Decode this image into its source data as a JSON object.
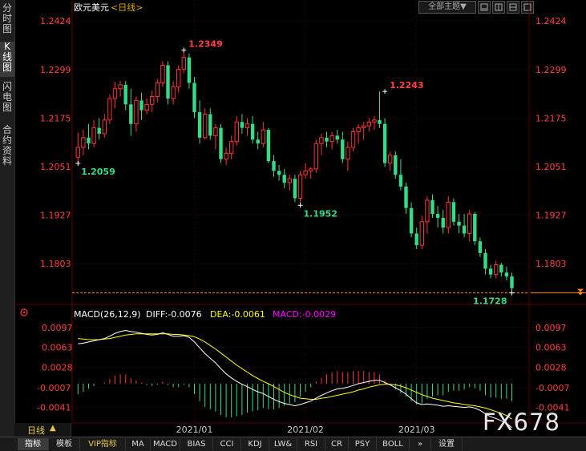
{
  "sidebar": {
    "tabs": [
      {
        "label": "分时图",
        "active": false
      },
      {
        "label": "K线图",
        "active": true
      },
      {
        "label": "闪电图",
        "active": false
      },
      {
        "label": "合约资料",
        "active": false
      }
    ]
  },
  "header": {
    "symbol": "欧元美元",
    "period_tag": "<日线>",
    "theme_dropdown": "全部主题",
    "dropdown_arrow": "▼"
  },
  "colors": {
    "up": "#ff3333",
    "down": "#33dd88",
    "axis_text_up": "#ff4040",
    "grid": "#4a0000",
    "diff_line": "#ffffff",
    "dea_line": "#ffff00",
    "macd_text": "#ff00ff",
    "last_price_line": "#ff8800"
  },
  "chart_data": [
    {
      "type": "candlestick",
      "title": "欧元美元<日线>",
      "ylim": [
        1.1715,
        1.244
      ],
      "y_ticks": [
        "1.2424",
        "1.2299",
        "1.2175",
        "1.2051",
        "1.1927",
        "1.1803"
      ],
      "x_ticks": [
        "2021/01",
        "2021/02",
        "2021/03"
      ],
      "x_tick_index": [
        22,
        43,
        64
      ],
      "annotations": [
        {
          "index": 20,
          "value": 1.2349,
          "label": "1.2349"
        },
        {
          "index": 58,
          "value": 1.2243,
          "label": "1.2243"
        },
        {
          "index": 0,
          "value": 1.2059,
          "label": "1.2059"
        },
        {
          "index": 42,
          "value": 1.1952,
          "label": "1.1952"
        },
        {
          "index": 82,
          "value": 1.1728,
          "label": "1.1728"
        }
      ],
      "last_price": 1.1728,
      "ohlc": [
        [
          1.2075,
          1.2138,
          1.2059,
          1.21
        ],
        [
          1.21,
          1.2145,
          1.208,
          1.2125
        ],
        [
          1.2125,
          1.216,
          1.2095,
          1.211
        ],
        [
          1.211,
          1.217,
          1.21,
          1.215
        ],
        [
          1.215,
          1.2175,
          1.212,
          1.2135
        ],
        [
          1.2135,
          1.2185,
          1.2125,
          1.217
        ],
        [
          1.217,
          1.2235,
          1.216,
          1.2225
        ],
        [
          1.2225,
          1.2268,
          1.22,
          1.225
        ],
        [
          1.225,
          1.227,
          1.223,
          1.226
        ],
        [
          1.226,
          1.227,
          1.2195,
          1.221
        ],
        [
          1.221,
          1.225,
          1.213,
          1.216
        ],
        [
          1.216,
          1.223,
          1.214,
          1.222
        ],
        [
          1.222,
          1.224,
          1.217,
          1.2195
        ],
        [
          1.2195,
          1.2225,
          1.2185,
          1.221
        ],
        [
          1.221,
          1.2245,
          1.219,
          1.223
        ],
        [
          1.223,
          1.2275,
          1.2215,
          1.2265
        ],
        [
          1.2265,
          1.232,
          1.2255,
          1.231
        ],
        [
          1.231,
          1.232,
          1.221,
          1.2225
        ],
        [
          1.2225,
          1.227,
          1.221,
          1.2255
        ],
        [
          1.2255,
          1.231,
          1.224,
          1.23
        ],
        [
          1.23,
          1.2349,
          1.229,
          1.233
        ],
        [
          1.233,
          1.234,
          1.225,
          1.2265
        ],
        [
          1.2265,
          1.228,
          1.2175,
          1.219
        ],
        [
          1.219,
          1.222,
          1.211,
          1.2125
        ],
        [
          1.2125,
          1.22,
          1.212,
          1.2185
        ],
        [
          1.2185,
          1.22,
          1.212,
          1.213
        ],
        [
          1.213,
          1.216,
          1.2095,
          1.215
        ],
        [
          1.215,
          1.216,
          1.206,
          1.207
        ],
        [
          1.207,
          1.21,
          1.2055,
          1.2085
        ],
        [
          1.2085,
          1.213,
          1.207,
          1.2115
        ],
        [
          1.2115,
          1.218,
          1.2105,
          1.2165
        ],
        [
          1.2165,
          1.2185,
          1.2135,
          1.215
        ],
        [
          1.215,
          1.2175,
          1.213,
          1.216
        ],
        [
          1.216,
          1.218,
          1.211,
          1.212
        ],
        [
          1.212,
          1.214,
          1.2095,
          1.211
        ],
        [
          1.211,
          1.2165,
          1.21,
          1.2145
        ],
        [
          1.2145,
          1.215,
          1.206,
          1.2065
        ],
        [
          1.2065,
          1.208,
          1.2025,
          1.204
        ],
        [
          1.204,
          1.2055,
          1.2015,
          1.203
        ],
        [
          1.203,
          1.2045,
          1.1995,
          1.201
        ],
        [
          1.201,
          1.203,
          1.199,
          1.202
        ],
        [
          1.202,
          1.203,
          1.196,
          1.197
        ],
        [
          1.197,
          1.204,
          1.1952,
          1.203
        ],
        [
          1.203,
          1.206,
          1.202,
          1.204
        ],
        [
          1.204,
          1.205,
          1.202,
          1.2045
        ],
        [
          1.2045,
          1.212,
          1.2035,
          1.211
        ],
        [
          1.211,
          1.2135,
          1.208,
          1.2125
        ],
        [
          1.2125,
          1.214,
          1.21,
          1.2115
        ],
        [
          1.2115,
          1.214,
          1.2095,
          1.213
        ],
        [
          1.213,
          1.2145,
          1.211,
          1.212
        ],
        [
          1.212,
          1.214,
          1.206,
          1.207
        ],
        [
          1.207,
          1.2115,
          1.204,
          1.21
        ],
        [
          1.21,
          1.215,
          1.209,
          1.214
        ],
        [
          1.214,
          1.216,
          1.211,
          1.215
        ],
        [
          1.215,
          1.2165,
          1.212,
          1.2155
        ],
        [
          1.2155,
          1.2175,
          1.214,
          1.2165
        ],
        [
          1.2165,
          1.218,
          1.2145,
          1.217
        ],
        [
          1.217,
          1.2243,
          1.215,
          1.216
        ],
        [
          1.216,
          1.2175,
          1.205,
          1.206
        ],
        [
          1.206,
          1.209,
          1.204,
          1.208
        ],
        [
          1.208,
          1.209,
          1.202,
          1.203
        ],
        [
          1.203,
          1.207,
          1.199,
          1.2
        ],
        [
          1.2,
          1.201,
          1.193,
          1.1945
        ],
        [
          1.1945,
          1.196,
          1.187,
          1.188
        ],
        [
          1.188,
          1.1895,
          1.184,
          1.185
        ],
        [
          1.185,
          1.1925,
          1.184,
          1.191
        ],
        [
          1.191,
          1.1975,
          1.188,
          1.1965
        ],
        [
          1.1965,
          1.198,
          1.192,
          1.193
        ],
        [
          1.193,
          1.195,
          1.1895,
          1.192
        ],
        [
          1.192,
          1.194,
          1.188,
          1.1895
        ],
        [
          1.1895,
          1.1975,
          1.188,
          1.196
        ],
        [
          1.196,
          1.197,
          1.19,
          1.191
        ],
        [
          1.191,
          1.193,
          1.188,
          1.19
        ],
        [
          1.19,
          1.193,
          1.187,
          1.188
        ],
        [
          1.188,
          1.194,
          1.186,
          1.193
        ],
        [
          1.193,
          1.1935,
          1.185,
          1.186
        ],
        [
          1.186,
          1.187,
          1.182,
          1.183
        ],
        [
          1.183,
          1.184,
          1.1775,
          1.179
        ],
        [
          1.179,
          1.18,
          1.1765,
          1.1775
        ],
        [
          1.1775,
          1.181,
          1.1765,
          1.18
        ],
        [
          1.18,
          1.1805,
          1.177,
          1.178
        ],
        [
          1.178,
          1.1795,
          1.176,
          1.177
        ],
        [
          1.177,
          1.178,
          1.1728,
          1.174
        ]
      ]
    },
    {
      "type": "macd",
      "title": "MACD(26,12,9)",
      "diff_label": "DIFF:-0.0076",
      "dea_label": "DEA:-0.0061",
      "macd_label": "MACD:-0.0029",
      "ylim": [
        -0.0065,
        0.0112
      ],
      "y_ticks": [
        "0.0097",
        "0.0063",
        "0.0028",
        "-0.0007",
        "-0.0041"
      ],
      "diff": [
        0.0069,
        0.007,
        0.0072,
        0.0074,
        0.0076,
        0.0078,
        0.0082,
        0.0087,
        0.009,
        0.0092,
        0.009,
        0.0089,
        0.0087,
        0.0085,
        0.0084,
        0.0085,
        0.0088,
        0.0085,
        0.0082,
        0.0082,
        0.0083,
        0.008,
        0.0072,
        0.0062,
        0.0052,
        0.0044,
        0.0036,
        0.0026,
        0.0017,
        0.001,
        0.0004,
        -0.0001,
        -0.0005,
        -0.001,
        -0.0014,
        -0.0017,
        -0.0022,
        -0.0027,
        -0.0031,
        -0.0034,
        -0.0036,
        -0.0038,
        -0.0036,
        -0.0033,
        -0.003,
        -0.0025,
        -0.002,
        -0.0016,
        -0.0012,
        -0.0009,
        -0.0008,
        -0.0006,
        -0.0003,
        0.0,
        0.0002,
        0.0004,
        0.0006,
        0.0006,
        0.0002,
        -0.0002,
        -0.0007,
        -0.0012,
        -0.0018,
        -0.0026,
        -0.0033,
        -0.0036,
        -0.0035,
        -0.0036,
        -0.0037,
        -0.0039,
        -0.0038,
        -0.0039,
        -0.004,
        -0.0041,
        -0.004,
        -0.0042,
        -0.0046,
        -0.0052,
        -0.0057,
        -0.006,
        -0.0064,
        -0.0068,
        -0.0076
      ],
      "dea": [
        0.0078,
        0.0077,
        0.0076,
        0.0076,
        0.0076,
        0.0077,
        0.0078,
        0.008,
        0.0082,
        0.0084,
        0.0085,
        0.0086,
        0.0086,
        0.0086,
        0.0086,
        0.0086,
        0.0086,
        0.0086,
        0.0085,
        0.0085,
        0.0084,
        0.0083,
        0.0081,
        0.0077,
        0.0072,
        0.0066,
        0.006,
        0.0053,
        0.0046,
        0.0039,
        0.0032,
        0.0026,
        0.002,
        0.0014,
        0.0009,
        0.0004,
        0.0,
        -0.0005,
        -0.001,
        -0.0015,
        -0.0019,
        -0.0022,
        -0.0025,
        -0.0026,
        -0.0027,
        -0.0027,
        -0.0025,
        -0.0024,
        -0.0022,
        -0.002,
        -0.0018,
        -0.0016,
        -0.0014,
        -0.0011,
        -0.0009,
        -0.0006,
        -0.0004,
        -0.0002,
        -0.0001,
        -0.0001,
        -0.0002,
        -0.0004,
        -0.0007,
        -0.0011,
        -0.0015,
        -0.0019,
        -0.0022,
        -0.0025,
        -0.0027,
        -0.0029,
        -0.0031,
        -0.0033,
        -0.0034,
        -0.0036,
        -0.0037,
        -0.0038,
        -0.004,
        -0.0042,
        -0.0045,
        -0.0048,
        -0.0051,
        -0.0055,
        -0.0061
      ],
      "hist": [
        -0.0018,
        -0.0014,
        -0.0008,
        -0.0004,
        0.0,
        0.0002,
        0.0008,
        0.0014,
        0.0016,
        0.0016,
        0.001,
        0.0006,
        0.0002,
        -0.0002,
        -0.0004,
        -0.0002,
        0.0004,
        -0.0002,
        -0.0006,
        -0.0006,
        -0.0002,
        -0.0006,
        -0.0018,
        -0.003,
        -0.004,
        -0.0044,
        -0.0048,
        -0.0054,
        -0.0058,
        -0.0058,
        -0.0056,
        -0.0054,
        -0.005,
        -0.0048,
        -0.0046,
        -0.0042,
        -0.0044,
        -0.0044,
        -0.0042,
        -0.0038,
        -0.0034,
        -0.0032,
        -0.0022,
        -0.0014,
        -0.0006,
        0.0004,
        0.001,
        0.0016,
        0.002,
        0.0022,
        0.002,
        0.002,
        0.0022,
        0.0022,
        0.0022,
        0.002,
        0.002,
        0.0016,
        0.0006,
        -0.0002,
        -0.001,
        -0.0016,
        -0.0022,
        -0.003,
        -0.0036,
        -0.0034,
        -0.0026,
        -0.0022,
        -0.002,
        -0.002,
        -0.0014,
        -0.0012,
        -0.0012,
        -0.001,
        -0.0006,
        -0.0008,
        -0.0012,
        -0.002,
        -0.0024,
        -0.0024,
        -0.0026,
        -0.0026,
        -0.003
      ]
    }
  ],
  "footer": {
    "period_label": "日线",
    "period_arrow": "▲",
    "tabs": [
      "指标",
      "模板",
      "VIP指标",
      "MA",
      "MACD",
      "BIAS",
      "CCI",
      "KDJ",
      "LW&",
      "RSI",
      "CR",
      "PSY",
      "BOLL",
      "»",
      "设置"
    ]
  },
  "watermark": "FX678"
}
